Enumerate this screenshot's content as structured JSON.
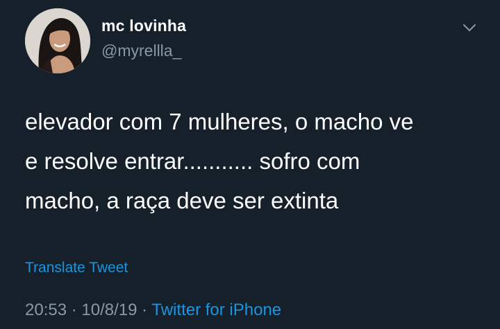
{
  "tweet": {
    "display_name": "mc lovinha",
    "handle": "@myrellla_",
    "text": "elevador com 7 mulheres, o macho ve\ne resolve entrar........... sofro com\nmacho, a raça deve ser extinta",
    "translate_label": "Translate Tweet",
    "time": "20:53",
    "separator": "·",
    "date": "10/8/19",
    "source": "Twitter for iPhone"
  },
  "icons": {
    "avatar": "profile-photo",
    "menu": "chevron-down-icon"
  },
  "colors": {
    "background": "#15202b",
    "primary_text": "#ffffff",
    "secondary_text": "#8899a6",
    "link": "#1b95e0"
  }
}
